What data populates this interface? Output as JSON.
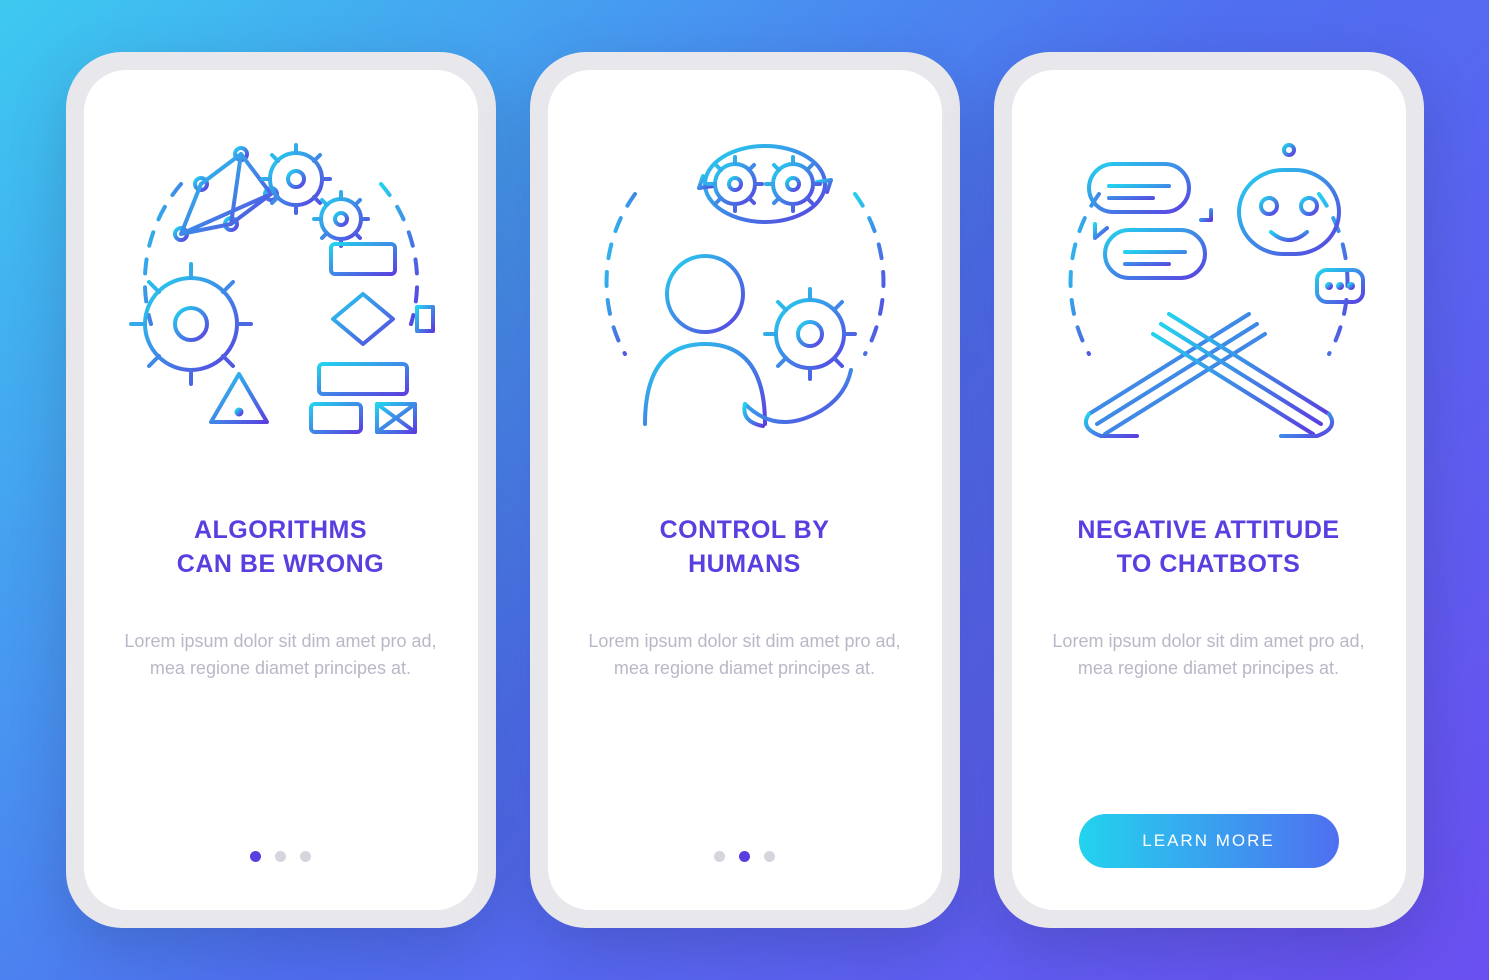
{
  "colors": {
    "accent": "#5a3fe0",
    "gradientStart": "#23d3ee",
    "gradientEnd": "#4f6ff0",
    "bodyText": "#b8b8c7"
  },
  "screens": [
    {
      "icon": "algorithm-gears-icon",
      "title": "ALGORITHMS\nCAN BE WRONG",
      "body": "Lorem ipsum dolor sit dim amet pro ad, mea regione diamet principes at.",
      "pagination": {
        "index": 0,
        "total": 3
      },
      "cta": null
    },
    {
      "icon": "human-control-icon",
      "title": "CONTROL BY\nHUMANS",
      "body": "Lorem ipsum dolor sit dim amet pro ad, mea regione diamet principes at.",
      "pagination": {
        "index": 1,
        "total": 3
      },
      "cta": null
    },
    {
      "icon": "chatbot-negative-icon",
      "title": "NEGATIVE ATTITUDE\nTO CHATBOTS",
      "body": "Lorem ipsum dolor sit dim amet pro ad, mea regione diamet principes at.",
      "pagination": null,
      "cta": "LEARN MORE"
    }
  ]
}
